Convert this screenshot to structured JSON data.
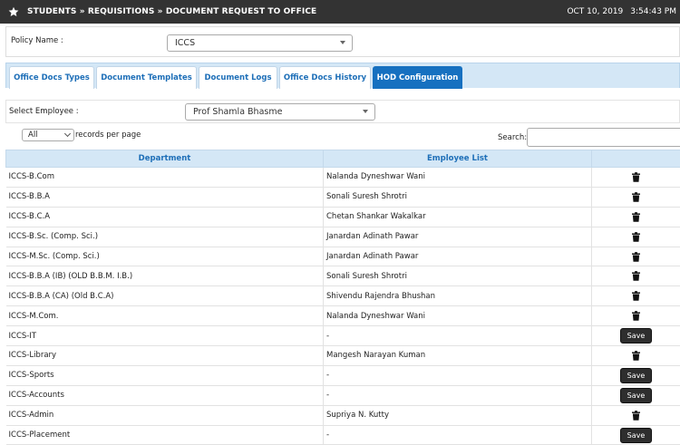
{
  "header": {
    "breadcrumb": "STUDENTS » REQUISITIONS » DOCUMENT REQUEST TO OFFICE",
    "date": "OCT 10, 2019",
    "time": "3:54:43 PM",
    "icon": "star-icon"
  },
  "policy": {
    "label": "Policy Name :",
    "value": "ICCS"
  },
  "tabs": [
    {
      "label": "Office Docs Types"
    },
    {
      "label": "Document Templates"
    },
    {
      "label": "Document Logs"
    },
    {
      "label": "Office Docs History"
    },
    {
      "label": "HOD Configuration",
      "active": true
    }
  ],
  "employee": {
    "label": "Select Employee :",
    "value": "Prof Shamla Bhasme"
  },
  "table_controls": {
    "length_value": "All",
    "length_label": "records per page",
    "search_label": "Search:"
  },
  "table": {
    "columns": [
      "Department",
      "Employee List",
      ""
    ],
    "rows": [
      {
        "department": "ICCS-B.Com",
        "employee": "Nalanda Dyneshwar Wani",
        "action": "delete"
      },
      {
        "department": "ICCS-B.B.A",
        "employee": "Sonali Suresh Shrotri",
        "action": "delete"
      },
      {
        "department": "ICCS-B.C.A",
        "employee": "Chetan Shankar Wakalkar",
        "action": "delete"
      },
      {
        "department": "ICCS-B.Sc. (Comp. Sci.)",
        "employee": "Janardan Adinath Pawar",
        "action": "delete"
      },
      {
        "department": "ICCS-M.Sc. (Comp. Sci.)",
        "employee": "Janardan Adinath Pawar",
        "action": "delete"
      },
      {
        "department": "ICCS-B.B.A (IB) (OLD B.B.M. I.B.)",
        "employee": "Sonali Suresh Shrotri",
        "action": "delete"
      },
      {
        "department": "ICCS-B.B.A (CA) (Old B.C.A)",
        "employee": "Shivendu Rajendra Bhushan",
        "action": "delete"
      },
      {
        "department": "ICCS-M.Com.",
        "employee": "Nalanda Dyneshwar Wani",
        "action": "delete"
      },
      {
        "department": "ICCS-IT",
        "employee": "-",
        "action": "save"
      },
      {
        "department": "ICCS-Library",
        "employee": "Mangesh Narayan Kuman",
        "action": "delete"
      },
      {
        "department": "ICCS-Sports",
        "employee": "-",
        "action": "save"
      },
      {
        "department": "ICCS-Accounts",
        "employee": "-",
        "action": "save"
      },
      {
        "department": "ICCS-Admin",
        "employee": "Supriya N. Kutty",
        "action": "delete"
      },
      {
        "department": "ICCS-Placement",
        "employee": "-",
        "action": "save"
      }
    ],
    "save_label": "Save"
  },
  "colors": {
    "topbar": "#333333",
    "tab_active": "#1670c0",
    "header_bg": "#d4e7f6",
    "link_blue": "#1e6fb8"
  }
}
